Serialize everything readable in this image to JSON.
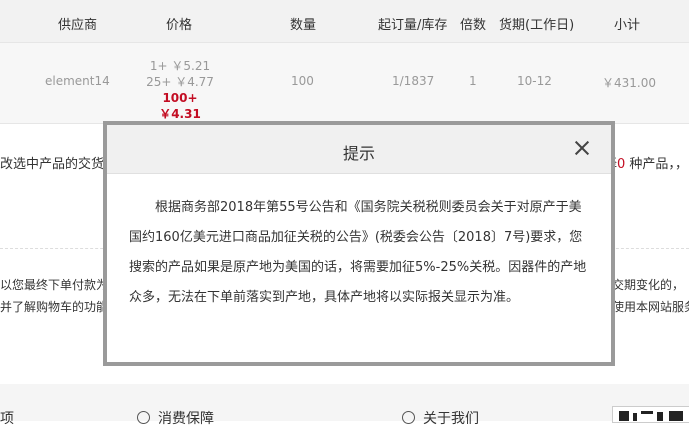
{
  "table_header": {
    "supplier": "供应商",
    "price": "价格",
    "quantity": "数量",
    "moq_stock": "起订量/库存",
    "multiple": "倍数",
    "lead_time": "货期(工作日)",
    "subtotal": "小计"
  },
  "product": {
    "supplier": "element14",
    "price_tiers": [
      {
        "label": "1+ ￥5.21"
      },
      {
        "label": "25+ ￥4.77"
      },
      {
        "label": "100+ ￥4.31"
      }
    ],
    "quantity": "100",
    "moq_stock": "1/1837",
    "multiple": "1",
    "lead_time": "10-12",
    "subtotal": "￥431.00"
  },
  "notice": {
    "left_text": "改选中产品的交货地",
    "right_prefix": "择",
    "right_count": "0",
    "right_suffix": " 种产品，"
  },
  "terms": {
    "line1_left": "以您最终下单付款为",
    "line1_right": "交期变化的，",
    "line2_left": "并了解购物车的功能",
    "line2_right": "使用本网站服务，"
  },
  "footer": {
    "item1": "项",
    "item2": "消费保障",
    "item3": "关于我们"
  },
  "modal": {
    "title": "提示",
    "body": "根据商务部2018年第55号公告和《国务院关税税则委员会关于对原产于美国约160亿美元进口商品加征关税的公告》(税委会公告〔2018〕7号)要求，您搜索的产品如果是原产地为美国的话，将需要加征5%-25%关税。因器件的产地众多，无法在下单前落实到产地，具体产地将以实际报关显示为准。"
  }
}
